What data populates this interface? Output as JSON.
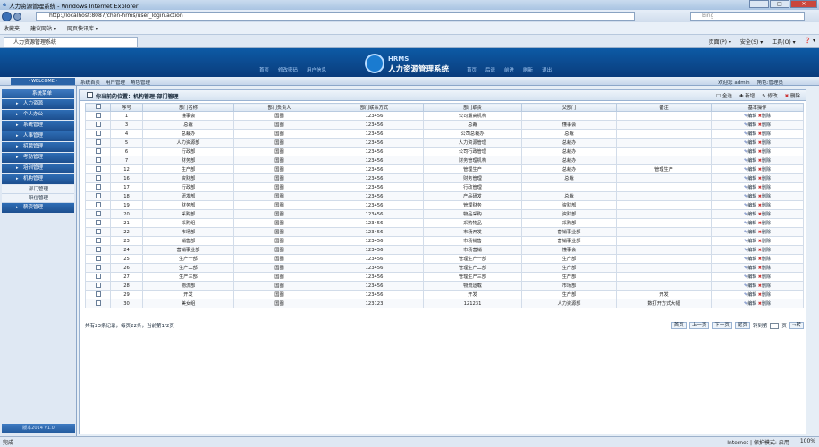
{
  "window": {
    "title": "人力资源管理系统 - Windows Internet Explorer",
    "min": "—",
    "max": "□",
    "close": "✕"
  },
  "address": {
    "url": "http://localhost:8087/chen-hrms/user_login.action",
    "search_placeholder": "Bing"
  },
  "favorites": {
    "label": "收藏夹",
    "item1": "建议网站 ▾",
    "item2": "网页快讯库 ▾"
  },
  "tab": {
    "title": "人力资源管理系统"
  },
  "ie_tools": {
    "page": "页面(P) ▾",
    "safety": "安全(S) ▾",
    "tools": "工具(O) ▾",
    "help": "❓ ▾"
  },
  "banner": {
    "brand_small": "HRMS",
    "brand_name": "人力资源管理系统",
    "nav_left": [
      "首页",
      "修改密码",
      "用户信息"
    ],
    "nav_right": [
      "首页",
      "后退",
      "前进",
      "刷新",
      "退出"
    ]
  },
  "subbar": {
    "welcome": "· WELCOME ·",
    "crumbs": [
      "系统首页",
      "用户管理",
      "角色管理"
    ],
    "user": "欢迎您 admin",
    "role": "角色:管理员"
  },
  "sidebar": {
    "head": "系统菜单",
    "foot": "版本2014 V1.0",
    "items": [
      "人力资源",
      "个人办公",
      "系统管理",
      "人事管理",
      "招聘管理",
      "考勤管理",
      "培训管理",
      "机构管理"
    ],
    "subitems": [
      "部门管理",
      "职位管理"
    ],
    "after": [
      "薪资管理"
    ]
  },
  "main": {
    "title": "你当前的位置：机构管理-部门管理",
    "actions": {
      "select_all": "全选",
      "add": "新增",
      "edit": "修改",
      "delete": "删除"
    },
    "columns": [
      "",
      "序号",
      "部门名称",
      "部门负责人",
      "部门联系方式",
      "部门职责",
      "父部门",
      "备注",
      "基本操作"
    ],
    "rows": [
      [
        "1",
        "懂事会",
        "国图",
        "123456",
        "公司最高机构",
        "",
        ""
      ],
      [
        "3",
        "总裁",
        "国图",
        "123456",
        "总裁",
        "懂事会",
        ""
      ],
      [
        "4",
        "总裁办",
        "国图",
        "123456",
        "公司总裁办",
        "总裁",
        ""
      ],
      [
        "5",
        "人力资源部",
        "国图",
        "123456",
        "人力资源管理",
        "总裁办",
        ""
      ],
      [
        "6",
        "行政部",
        "国图",
        "123456",
        "公司行政管理",
        "总裁办",
        ""
      ],
      [
        "7",
        "财务部",
        "国图",
        "123456",
        "财务管理机构",
        "总裁办",
        ""
      ],
      [
        "12",
        "生产部",
        "国图",
        "123456",
        "管理生产",
        "总裁办",
        "管理生产"
      ],
      [
        "16",
        "资财部",
        "国图",
        "123456",
        "财务管理",
        "总裁",
        ""
      ],
      [
        "17",
        "行政部",
        "国图",
        "123456",
        "行政管理",
        "",
        ""
      ],
      [
        "18",
        "研发部",
        "国图",
        "123456",
        "产品研发",
        "总裁",
        ""
      ],
      [
        "19",
        "财务部",
        "国图",
        "123456",
        "管理财务",
        "资财部",
        ""
      ],
      [
        "20",
        "采购部",
        "国图",
        "123456",
        "物品采购",
        "资财部",
        ""
      ],
      [
        "21",
        "采购组",
        "国图",
        "123456",
        "采购物品",
        "采购部",
        ""
      ],
      [
        "22",
        "市场部",
        "国图",
        "123456",
        "市场开发",
        "营销事业部",
        ""
      ],
      [
        "23",
        "销售部",
        "国图",
        "123456",
        "市场销售",
        "营销事业部",
        ""
      ],
      [
        "24",
        "营销事业部",
        "国图",
        "123456",
        "市场营销",
        "懂事会",
        ""
      ],
      [
        "25",
        "生产一部",
        "国图",
        "123456",
        "管理生产一部",
        "生产部",
        ""
      ],
      [
        "26",
        "生产二部",
        "国图",
        "123456",
        "管理生产二部",
        "生产部",
        ""
      ],
      [
        "27",
        "生产三部",
        "国图",
        "123456",
        "管理生产三部",
        "生产部",
        ""
      ],
      [
        "28",
        "物流部",
        "国图",
        "123456",
        "物流运载",
        "市场部",
        ""
      ],
      [
        "29",
        "开发",
        "国图",
        "123456",
        "开发",
        "生产部",
        "开发"
      ],
      [
        "30",
        "美女组",
        "国图",
        "123123",
        "121231",
        "人力资源部",
        "数打开方式大幅"
      ]
    ],
    "op_edit": "编辑",
    "op_delete": "删除"
  },
  "pager": {
    "summary": "共有23条记录，每页22条，当前第1/2页",
    "first": "首页",
    "prev": "上一页",
    "next": "下一页",
    "last": "尾页",
    "goto": "转到第",
    "page_unit": "页",
    "go": "➡转"
  },
  "status": {
    "left": "完成",
    "zone": "Internet | 保护模式: 启用",
    "zoom": "100%"
  }
}
